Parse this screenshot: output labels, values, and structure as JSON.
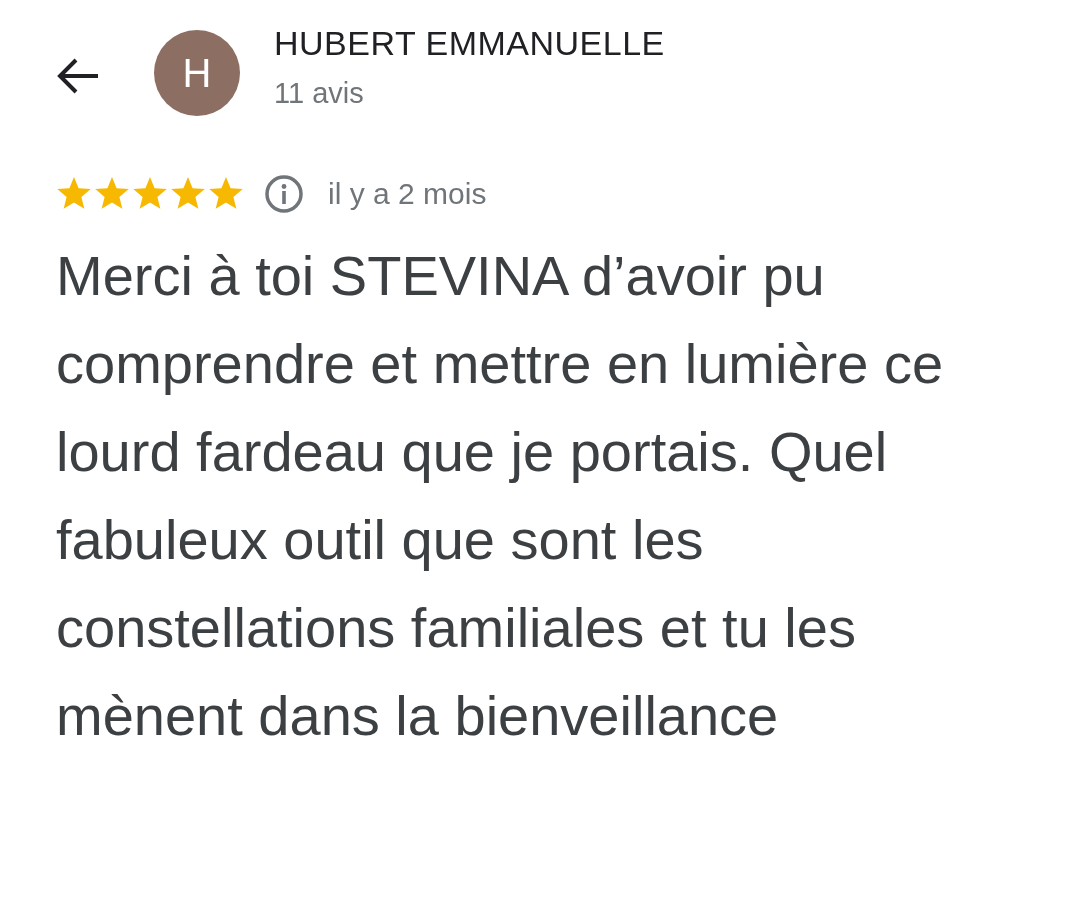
{
  "reviewer": {
    "avatar_letter": "H",
    "name": "HUBERT EMMANUELLE",
    "review_count": "11 avis"
  },
  "review": {
    "stars": 5,
    "time": "il y a 2 mois",
    "text": "Merci à toi STEVINA d’avoir pu comprendre et mettre en lumière ce lourd fardeau que je portais. Quel fabuleux outil que sont les constellations familiales et tu les mènent dans la bienveillance"
  }
}
